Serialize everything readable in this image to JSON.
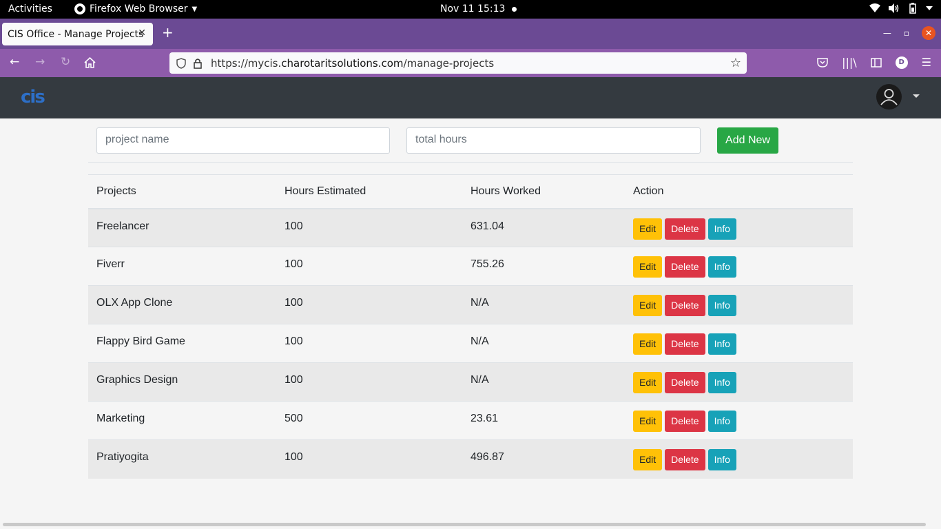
{
  "system_bar": {
    "activities": "Activities",
    "app_name": "Firefox Web Browser",
    "datetime": "Nov 11  15:13"
  },
  "browser": {
    "tab_title": "CIS Office - Manage Projects",
    "url_prefix": "https://mycis.",
    "url_domain": "charotaritsolutions.com",
    "url_path": "/manage-projects",
    "account_initial": "D"
  },
  "app": {
    "logo_text": "cis"
  },
  "form": {
    "project_name_placeholder": "project name",
    "total_hours_placeholder": "total hours",
    "add_button": "Add New"
  },
  "table": {
    "headers": [
      "Projects",
      "Hours Estimated",
      "Hours Worked",
      "Action"
    ],
    "rows": [
      {
        "project": "Freelancer",
        "estimated": "100",
        "worked": "631.04"
      },
      {
        "project": "Fiverr",
        "estimated": "100",
        "worked": "755.26"
      },
      {
        "project": "OLX App Clone",
        "estimated": "100",
        "worked": "N/A"
      },
      {
        "project": "Flappy Bird Game",
        "estimated": "100",
        "worked": "N/A"
      },
      {
        "project": "Graphics Design",
        "estimated": "100",
        "worked": "N/A"
      },
      {
        "project": "Marketing",
        "estimated": "500",
        "worked": "23.61"
      },
      {
        "project": "Pratiyogita",
        "estimated": "100",
        "worked": "496.87"
      }
    ],
    "action_labels": {
      "edit": "Edit",
      "delete": "Delete",
      "info": "Info"
    }
  },
  "colors": {
    "success": "#28a745",
    "warning": "#ffc107",
    "danger": "#dc3545",
    "info": "#17a2b8",
    "header_bg": "#343a40",
    "browser_tabstrip": "#6b4a94",
    "browser_navbar": "#8e5bab"
  }
}
